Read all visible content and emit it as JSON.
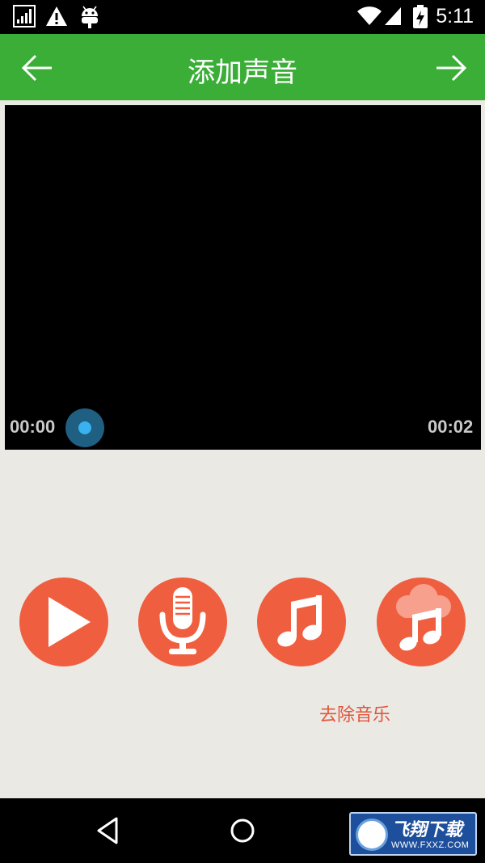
{
  "status_bar": {
    "time": "5:11",
    "icons": [
      "signal-icon",
      "warning-icon",
      "android-icon",
      "wifi-icon",
      "cell-signal-icon",
      "battery-charging-icon"
    ]
  },
  "app_bar": {
    "title": "添加声音",
    "back_icon": "arrow-left-icon",
    "forward_icon": "arrow-right-icon",
    "color": "#3aae36"
  },
  "video_player": {
    "current_time": "00:00",
    "duration": "00:02",
    "progress": 0
  },
  "actions": [
    {
      "name": "play-button",
      "icon": "play-icon"
    },
    {
      "name": "record-voice-button",
      "icon": "microphone-icon"
    },
    {
      "name": "add-music-button",
      "icon": "music-note-icon"
    },
    {
      "name": "online-music-button",
      "icon": "cloud-music-icon"
    }
  ],
  "remove_music_label": "去除音乐",
  "accent_color": "#ef5f3f",
  "nav_bar": {
    "icons": [
      "back-triangle-icon",
      "home-circle-icon"
    ]
  },
  "watermark": {
    "title": "飞翔下载",
    "url": "WWW.FXXZ.COM"
  }
}
